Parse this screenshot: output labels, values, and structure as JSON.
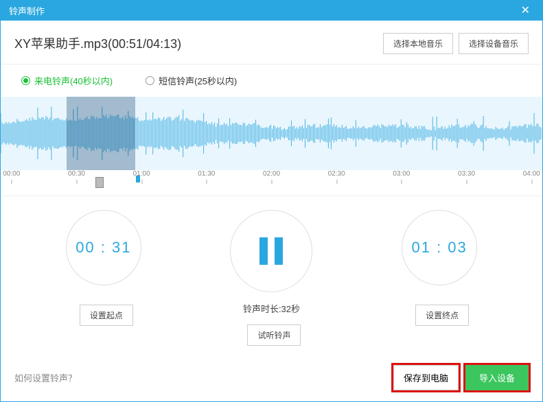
{
  "titlebar": {
    "title": "铃声制作"
  },
  "track": {
    "title": "XY苹果助手.mp3(00:51/04:13)"
  },
  "buttons": {
    "selectLocal": "选择本地音乐",
    "selectDevice": "选择设备音乐",
    "setStart": "设置起点",
    "setEnd": "设置终点",
    "preview": "试听铃声",
    "saveToPc": "保存到电脑",
    "importDevice": "导入设备"
  },
  "radios": {
    "call": "来电铃声(40秒以内)",
    "sms": "短信铃声(25秒以内)"
  },
  "ruler": [
    "00:00",
    "00:30",
    "01:00",
    "01:30",
    "02:00",
    "02:30",
    "03:00",
    "03:30",
    "04:00"
  ],
  "startTime": "00 : 31",
  "endTime": "01 : 03",
  "duration": "铃声时长:32秒",
  "help": "如何设置铃声？",
  "selection": {
    "startPct": 12.2,
    "endPct": 24.9
  }
}
